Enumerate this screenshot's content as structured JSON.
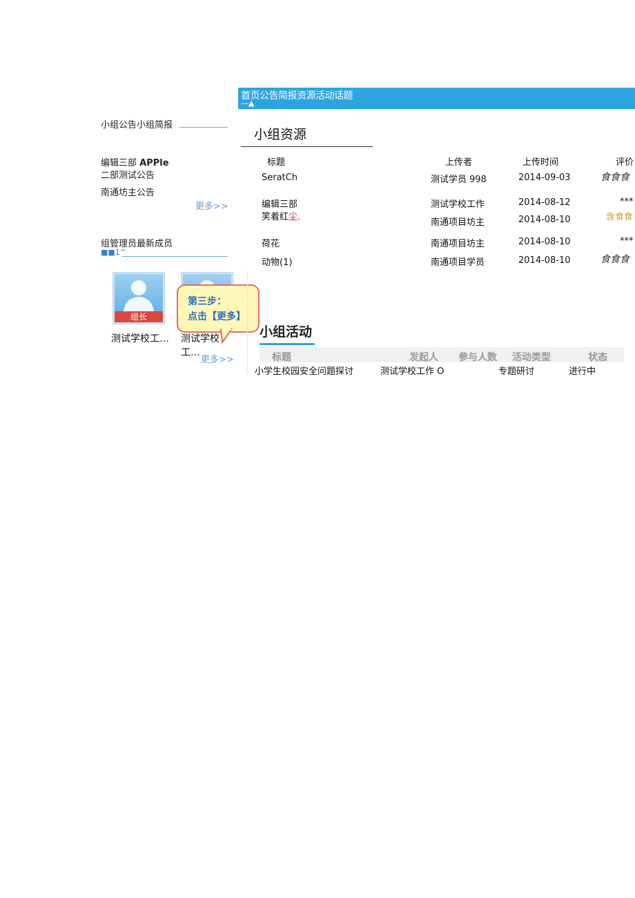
{
  "nav": {
    "items": [
      "首页",
      "公告",
      "简报",
      "资源",
      "活动",
      "话题"
    ],
    "caret": "—▲"
  },
  "left": {
    "tabs_label": "小组公告小组简报",
    "notices": [
      {
        "text": "编辑三部",
        "suffix": "APPle"
      },
      {
        "text": "二部测试公告"
      },
      {
        "text": "南通坊主公告"
      }
    ],
    "notices_more": "更多>>",
    "members_tabs": "组管理员最新成员",
    "members_marker": "■■1^",
    "members": [
      {
        "name": "测试学校工…",
        "role": "组长",
        "icon": "user-avatar-icon"
      },
      {
        "name": "测试学校工…",
        "role": "",
        "icon": "user-avatar-icon"
      }
    ],
    "members_more": "更多>>",
    "callout": {
      "line1": "第三步：",
      "line2": "点击【更多】"
    }
  },
  "resources": {
    "title": "小组资源",
    "headers": {
      "title": "标题",
      "uploader": "上传者",
      "time": "上传时间",
      "rating": "评价"
    },
    "rows": [
      {
        "title": "SeratCh",
        "title2": "",
        "title2_red": "",
        "uploader": "测试学员 998",
        "time": "2014-09-03",
        "rating": "食食食"
      },
      {
        "title": "编辑三部",
        "title2": "笑着红",
        "title2_red": "尘.",
        "uploader": "测试学校工作",
        "time": "2014-08-12",
        "rating": "***"
      },
      {
        "title": "",
        "title2": "",
        "title2_red": "",
        "uploader": "南通项目坊主",
        "time": "2014-08-10",
        "rating": "含食食"
      },
      {
        "title": "荷花",
        "title2": "",
        "title2_red": "",
        "uploader": "南通项目坊主",
        "time": "2014-08-10",
        "rating": "***"
      },
      {
        "title": "动物(1)",
        "title2": "",
        "title2_red": "",
        "uploader": "南通项目学员",
        "time": "2014-08-10",
        "rating": "食食食"
      }
    ]
  },
  "activities": {
    "title": "小组活动",
    "headers": {
      "title": "标题",
      "initiator": "发起人",
      "count": "参与人数",
      "type": "活动类型",
      "status": "状态"
    },
    "rows": [
      {
        "title": "小学生校园安全问题探讨",
        "initiator": "测试学校工作 O",
        "type": "专题研讨",
        "status": "进行中"
      }
    ]
  },
  "colors": {
    "nav_bg": "#2ca4e0",
    "link": "#6a9ed0",
    "callout_border": "#e86a6a",
    "callout_bg": "#fff7b8",
    "role_badge": "#d9473f"
  }
}
